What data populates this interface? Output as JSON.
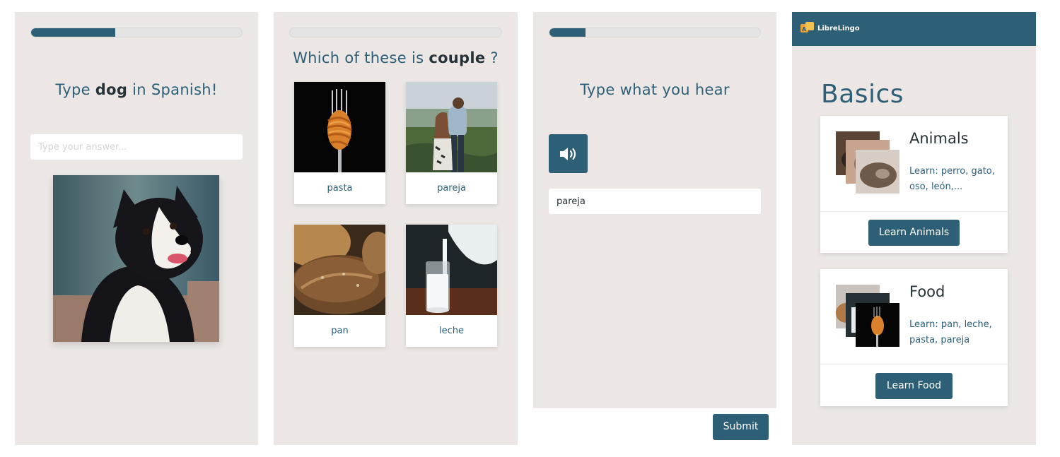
{
  "panel_type": {
    "progress": 0.4,
    "prompt_prefix": "Type",
    "prompt_word": "dog",
    "prompt_suffix": "in Spanish!",
    "input_placeholder": "Type your answer...",
    "image": "dog-photo"
  },
  "panel_choose": {
    "progress": 0,
    "prompt_prefix": "Which of these is",
    "prompt_word": "couple",
    "prompt_suffix": "?",
    "cards": [
      {
        "label": "pasta",
        "image": "pasta-photo"
      },
      {
        "label": "pareja",
        "image": "couple-photo"
      },
      {
        "label": "pan",
        "image": "bread-photo"
      },
      {
        "label": "leche",
        "image": "milk-photo"
      }
    ]
  },
  "panel_listen": {
    "progress": 0.17,
    "prompt": "Type what you hear",
    "audio_icon": "speaker-icon",
    "input_value": "pareja",
    "submit_label": "Submit"
  },
  "panel_course": {
    "brand": "LibreLingo",
    "section_title": "Basics",
    "skills": [
      {
        "name": "Animals",
        "description": "Learn: perro, gato, oso, león,...",
        "button": "Learn Animals"
      },
      {
        "name": "Food",
        "description": "Learn: pan, leche, pasta, pareja",
        "button": "Learn Food"
      }
    ]
  },
  "colors": {
    "accent": "#2d5f77",
    "panel_bg": "#ece7e5",
    "text": "#2c5f78"
  }
}
